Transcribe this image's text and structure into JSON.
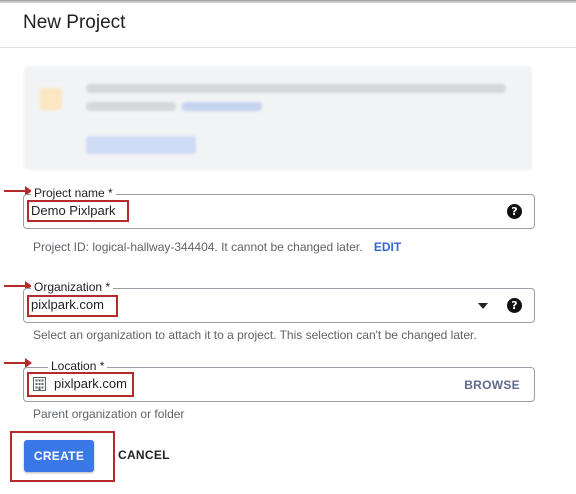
{
  "dialog": {
    "title": "New Project"
  },
  "project_name": {
    "label": "Project name *",
    "value": "Demo Pixlpark",
    "help_icon": "help-icon",
    "hint": "Project ID: logical-hallway-344404. It cannot be changed later.",
    "edit_label": "EDIT"
  },
  "organization": {
    "label": "Organization *",
    "value": "pixlpark.com",
    "hint": "Select an organization to attach it to a project. This selection can't be changed later."
  },
  "location": {
    "label": "Location *",
    "value": "pixlpark.com",
    "browse_label": "BROWSE",
    "hint": "Parent organization or folder",
    "icon": "building-icon"
  },
  "actions": {
    "create_label": "CREATE",
    "cancel_label": "CANCEL"
  },
  "colors": {
    "primary": "#3b78e7",
    "annotation": "#b52a2a",
    "link": "#3367d6"
  }
}
